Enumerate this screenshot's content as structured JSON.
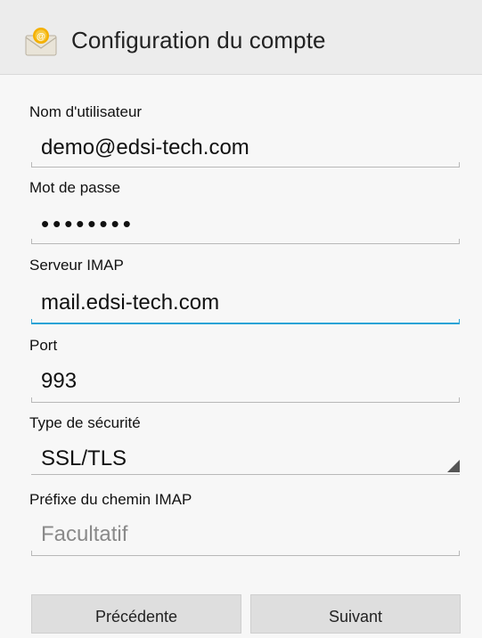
{
  "header": {
    "title": "Configuration du compte",
    "icon": "email-app-icon"
  },
  "form": {
    "username": {
      "label": "Nom d'utilisateur",
      "value": "demo@edsi-tech.com"
    },
    "password": {
      "label": "Mot de passe",
      "value": "••••••••"
    },
    "server": {
      "label": "Serveur IMAP",
      "value": "mail.edsi-tech.com"
    },
    "port": {
      "label": "Port",
      "value": "993"
    },
    "security": {
      "label": "Type de sécurité",
      "value": "SSL/TLS"
    },
    "prefix": {
      "label": "Préfixe du chemin IMAP",
      "placeholder": "Facultatif"
    }
  },
  "buttons": {
    "previous": "Précédente",
    "next": "Suivant"
  },
  "colors": {
    "accent": "#2aa3d6",
    "header_bg": "#ececec",
    "body_bg": "#f7f7f7"
  }
}
